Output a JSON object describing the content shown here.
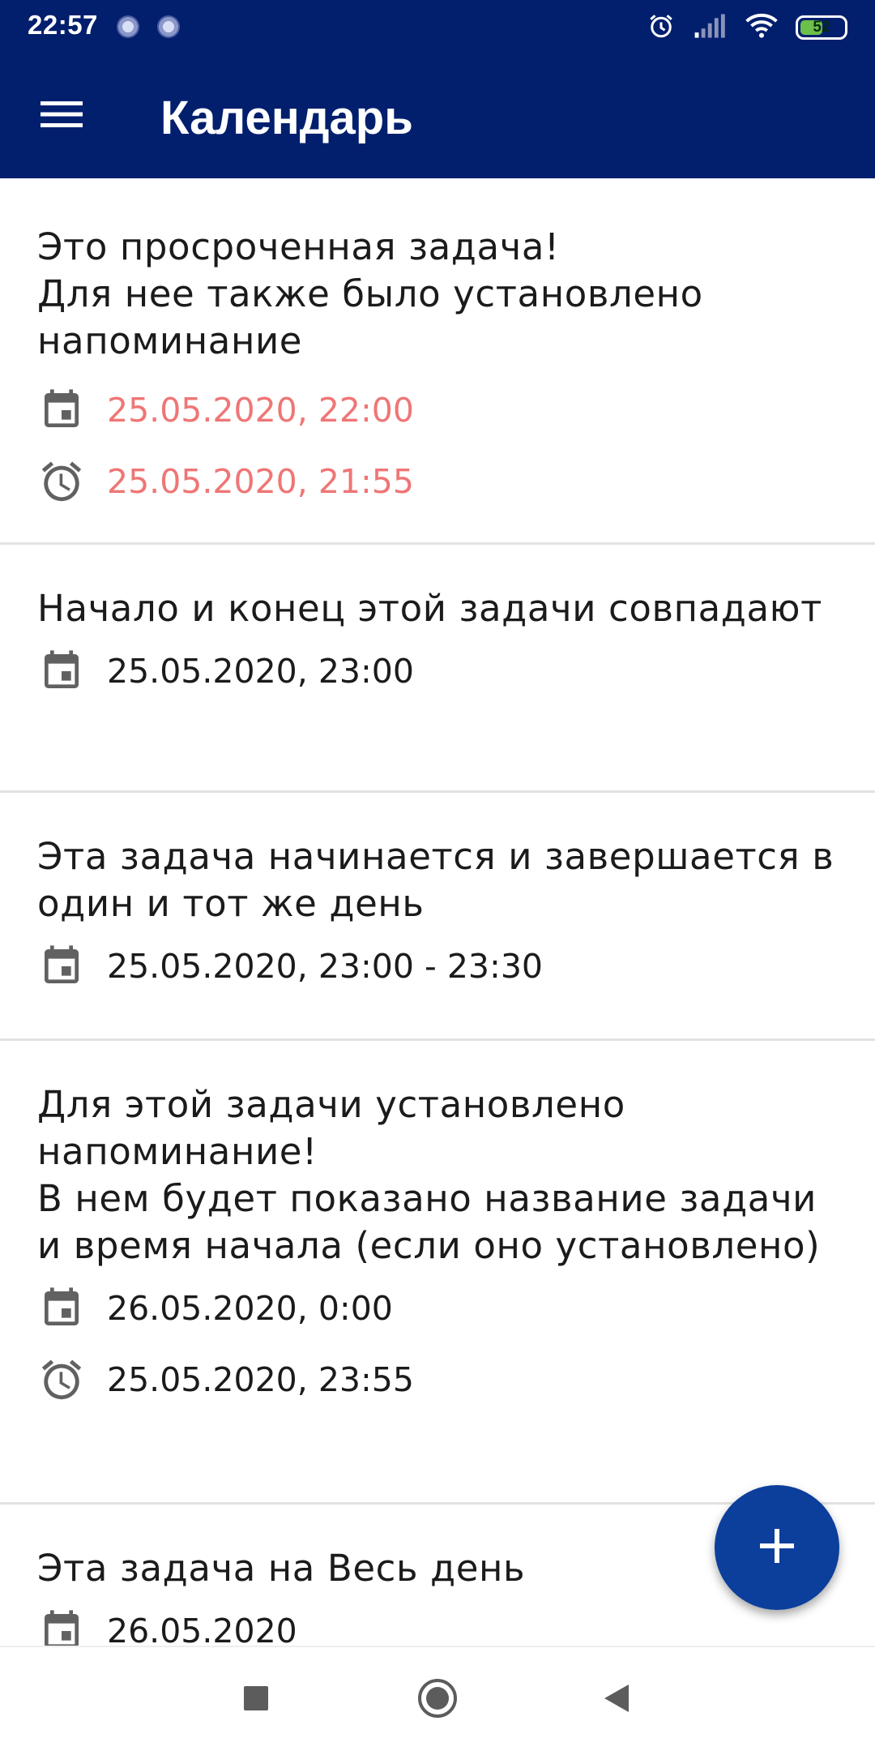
{
  "status_bar": {
    "time": "22:57",
    "battery_percent": "52",
    "battery_level": 0.52,
    "icons": [
      "alarm-icon",
      "signal-icon",
      "wifi-icon",
      "battery-icon"
    ]
  },
  "app_bar": {
    "title": "Календарь",
    "menu_icon": "hamburger-menu-icon"
  },
  "tasks": [
    {
      "title": "Это просроченная задача!\nДля нее также было установлено напоминание",
      "date": "25.05.2020, 22:00",
      "reminder": "25.05.2020, 21:55",
      "overdue": true
    },
    {
      "title": "Начало и конец этой задачи совпадают",
      "date": "25.05.2020, 23:00"
    },
    {
      "title": "Эта задача начинается и завершается в один и тот же день",
      "date": "25.05.2020, 23:00 - 23:30"
    },
    {
      "title": "Для этой задачи установлено напоминание!\nВ нем будет показано название задачи и время начала (если оно установлено)",
      "date": "26.05.2020, 0:00",
      "reminder": "25.05.2020, 23:55"
    },
    {
      "title": "Эта задача на Весь день",
      "date": "26.05.2020"
    }
  ],
  "fab": {
    "icon": "plus-icon"
  },
  "nav_bar": {
    "icons": [
      "recents-square-icon",
      "home-circle-icon",
      "back-triangle-icon"
    ]
  },
  "colors": {
    "primary": "#021f6e",
    "fab": "#0c3f9c",
    "overdue_text": "#ef7676",
    "icon_gray": "#616161",
    "divider": "#e2e2e2"
  }
}
